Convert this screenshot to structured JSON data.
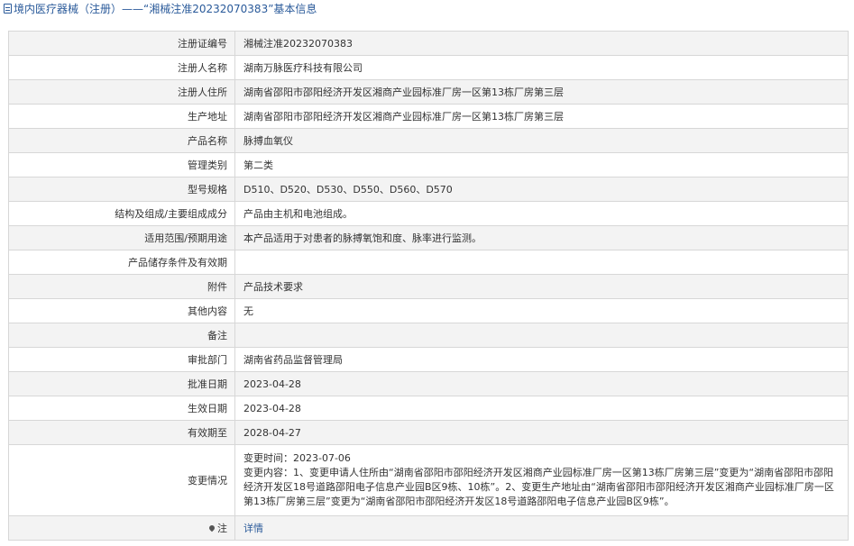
{
  "header": {
    "title": "境内医疗器械（注册）——“湘械注准20232070383”基本信息"
  },
  "rows": [
    {
      "label": "注册证编号",
      "value": "湘械注准20232070383"
    },
    {
      "label": "注册人名称",
      "value": "湖南万脉医疗科技有限公司"
    },
    {
      "label": "注册人住所",
      "value": "湖南省邵阳市邵阳经济开发区湘商产业园标准厂房一区第13栋厂房第三层"
    },
    {
      "label": "生产地址",
      "value": "湖南省邵阳市邵阳经济开发区湘商产业园标准厂房一区第13栋厂房第三层"
    },
    {
      "label": "产品名称",
      "value": "脉搏血氧仪"
    },
    {
      "label": "管理类别",
      "value": "第二类"
    },
    {
      "label": "型号规格",
      "value": "D510、D520、D530、D550、D560、D570"
    },
    {
      "label": "结构及组成/主要组成成分",
      "value": "产品由主机和电池组成。"
    },
    {
      "label": "适用范围/预期用途",
      "value": "本产品适用于对患者的脉搏氧饱和度、脉率进行监测。"
    },
    {
      "label": "产品储存条件及有效期",
      "value": ""
    },
    {
      "label": "附件",
      "value": "产品技术要求"
    },
    {
      "label": "其他内容",
      "value": "无"
    },
    {
      "label": "备注",
      "value": ""
    },
    {
      "label": "审批部门",
      "value": "湖南省药品监督管理局"
    },
    {
      "label": "批准日期",
      "value": "2023-04-28"
    },
    {
      "label": "生效日期",
      "value": "2023-04-28"
    },
    {
      "label": "有效期至",
      "value": "2028-04-27"
    }
  ],
  "change": {
    "label": "变更情况",
    "time_line": "变更时间：2023-07-06",
    "content": "变更内容：1、变更申请人住所由“湖南省邵阳市邵阳经济开发区湘商产业园标准厂房一区第13栋厂房第三层”变更为“湖南省邵阳市邵阳经济开发区18号道路邵阳电子信息产业园B区9栋、10栋”。2、变更生产地址由“湖南省邵阳市邵阳经济开发区湘商产业园标准厂房一区第13栋厂房第三层”变更为“湖南省邵阳市邵阳经济开发区18号道路邵阳电子信息产业园B区9栋”。"
  },
  "note": {
    "label": "注",
    "link_text": "详情"
  }
}
